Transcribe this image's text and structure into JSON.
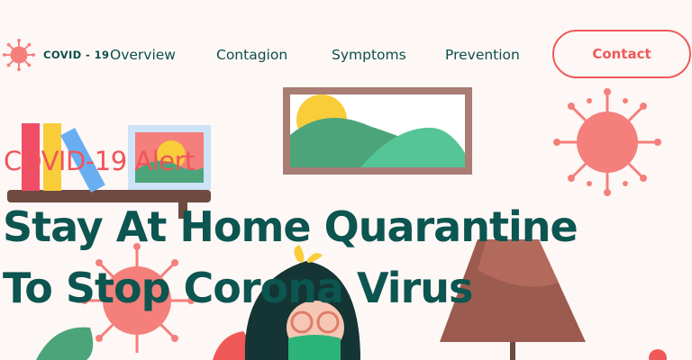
{
  "brand": {
    "name": "COVID - 19",
    "icon": "virus-icon",
    "color": "#ef6b6b"
  },
  "nav": {
    "items": [
      {
        "label": "Overview"
      },
      {
        "label": "Contagion"
      },
      {
        "label": "Symptoms"
      },
      {
        "label": "Prevention"
      }
    ],
    "contact_label": "Contact"
  },
  "hero": {
    "eyebrow": "COVID-19 Alert",
    "headline_line1": "Stay At Home Quarantine",
    "headline_line2": "To Stop Corona Virus"
  },
  "colors": {
    "background": "#fdf7f6",
    "accent": "#ef5a58",
    "heading": "#0c5550",
    "nav_text": "#0d4f4a",
    "virus": "#f47f7b"
  }
}
